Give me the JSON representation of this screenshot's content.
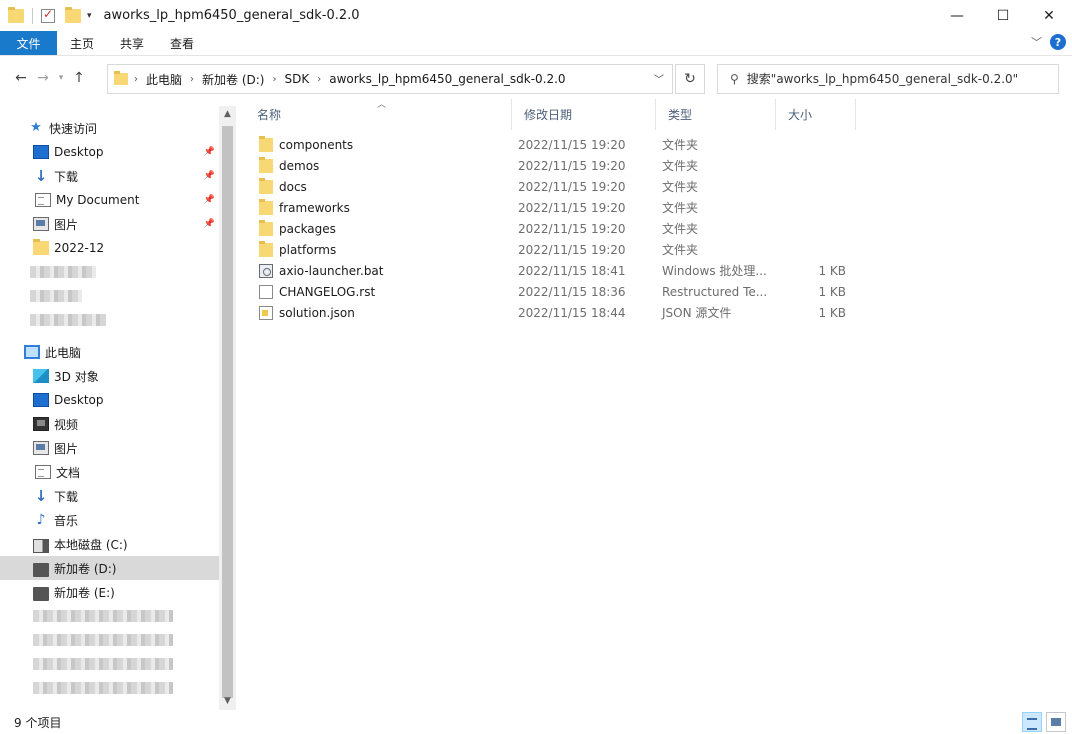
{
  "window": {
    "title": "aworks_lp_hpm6450_general_sdk-0.2.0",
    "minimize": "—",
    "maximize": "☐",
    "close": "✕"
  },
  "ribbon": {
    "tabs": [
      "文件",
      "主页",
      "共享",
      "查看"
    ]
  },
  "address": {
    "crumbs": [
      "此电脑",
      "新加卷 (D:)",
      "SDK",
      "aworks_lp_hpm6450_general_sdk-0.2.0"
    ]
  },
  "search": {
    "placeholder": "搜索\"aworks_lp_hpm6450_general_sdk-0.2.0\""
  },
  "sidebar": {
    "quick_access": "快速访问",
    "quick_items": [
      {
        "label": "Desktop",
        "icon": "desktop-icon",
        "pinned": true
      },
      {
        "label": "下载",
        "icon": "download-icon",
        "pinned": true
      },
      {
        "label": "My Document",
        "icon": "document-icon",
        "pinned": true
      },
      {
        "label": "图片",
        "icon": "picture-icon",
        "pinned": true
      },
      {
        "label": "2022-12",
        "icon": "folder-icon",
        "pinned": false
      }
    ],
    "this_pc": "此电脑",
    "pc_items": [
      {
        "label": "3D 对象",
        "icon": "3d-objects-icon"
      },
      {
        "label": "Desktop",
        "icon": "desktop-icon"
      },
      {
        "label": "视频",
        "icon": "video-icon"
      },
      {
        "label": "图片",
        "icon": "picture-icon"
      },
      {
        "label": "文档",
        "icon": "document-icon"
      },
      {
        "label": "下载",
        "icon": "download-icon"
      },
      {
        "label": "音乐",
        "icon": "music-icon"
      },
      {
        "label": "本地磁盘 (C:)",
        "icon": "local-disk-icon"
      },
      {
        "label": "新加卷 (D:)",
        "icon": "drive-icon",
        "selected": true
      },
      {
        "label": "新加卷 (E:)",
        "icon": "drive-icon"
      }
    ]
  },
  "columns": {
    "name": "名称",
    "date": "修改日期",
    "type": "类型",
    "size": "大小"
  },
  "files": [
    {
      "name": "components",
      "date": "2022/11/15 19:20",
      "type": "文件夹",
      "size": "",
      "kind": "folder"
    },
    {
      "name": "demos",
      "date": "2022/11/15 19:20",
      "type": "文件夹",
      "size": "",
      "kind": "folder"
    },
    {
      "name": "docs",
      "date": "2022/11/15 19:20",
      "type": "文件夹",
      "size": "",
      "kind": "folder"
    },
    {
      "name": "frameworks",
      "date": "2022/11/15 19:20",
      "type": "文件夹",
      "size": "",
      "kind": "folder"
    },
    {
      "name": "packages",
      "date": "2022/11/15 19:20",
      "type": "文件夹",
      "size": "",
      "kind": "folder"
    },
    {
      "name": "platforms",
      "date": "2022/11/15 19:20",
      "type": "文件夹",
      "size": "",
      "kind": "folder"
    },
    {
      "name": "axio-launcher.bat",
      "date": "2022/11/15 18:41",
      "type": "Windows 批处理...",
      "size": "1 KB",
      "kind": "bat"
    },
    {
      "name": "CHANGELOG.rst",
      "date": "2022/11/15 18:36",
      "type": "Restructured Te...",
      "size": "1 KB",
      "kind": "file"
    },
    {
      "name": "solution.json",
      "date": "2022/11/15 18:44",
      "type": "JSON 源文件",
      "size": "1 KB",
      "kind": "json"
    }
  ],
  "status": {
    "item_count": "9 个项目"
  }
}
